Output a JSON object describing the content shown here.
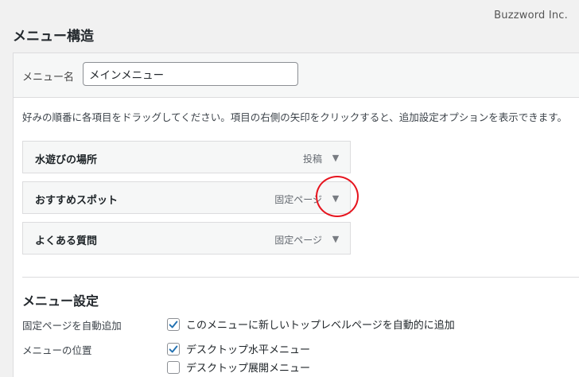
{
  "watermark": "Buzzword Inc.",
  "page_title": "メニュー構造",
  "menu_name": {
    "label": "メニュー名",
    "value": "メインメニュー"
  },
  "instructions": "好みの順番に各項目をドラッグしてください。項目の右側の矢印をクリックすると、追加設定オプションを表示できます。",
  "menu_items": [
    {
      "title": "水遊びの場所",
      "type": "投稿"
    },
    {
      "title": "おすすめスポット",
      "type": "固定ページ"
    },
    {
      "title": "よくある質問",
      "type": "固定ページ"
    }
  ],
  "settings": {
    "title": "メニュー設定",
    "auto_add": {
      "label": "固定ページを自動追加",
      "option": "このメニューに新しいトップレベルページを自動的に追加",
      "checked": true
    },
    "location": {
      "label": "メニューの位置",
      "options": [
        {
          "label": "デスクトップ水平メニュー",
          "checked": true
        },
        {
          "label": "デスクトップ展開メニュー",
          "checked": false
        }
      ]
    }
  },
  "colors": {
    "highlight": "#e6141e",
    "check": "#2271b1"
  }
}
